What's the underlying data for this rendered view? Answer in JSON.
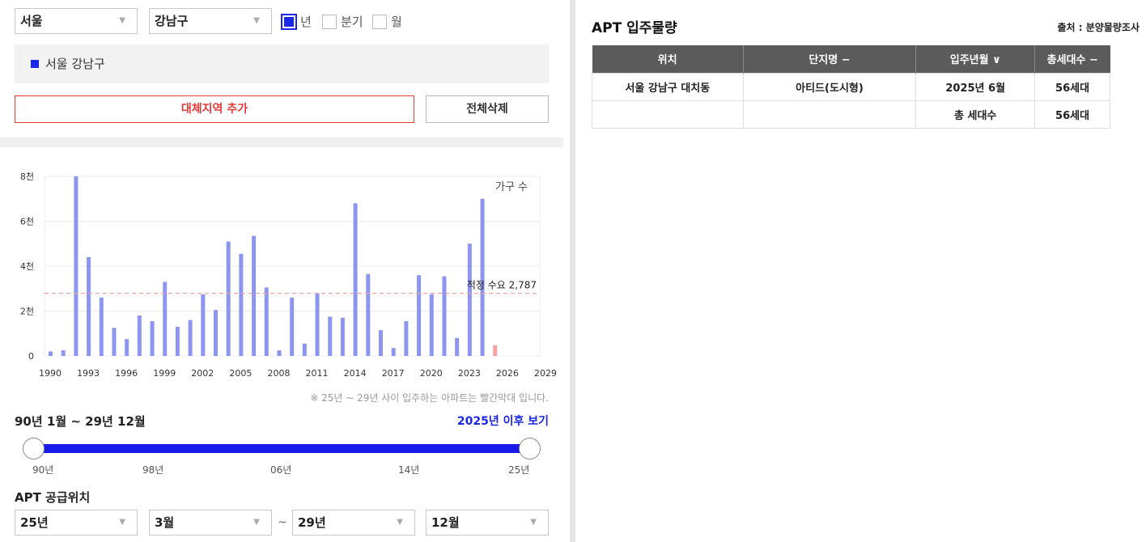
{
  "filters": {
    "city": "서울",
    "district": "강남구",
    "period_options": [
      {
        "label": "년",
        "checked": true
      },
      {
        "label": "분기",
        "checked": false
      },
      {
        "label": "월",
        "checked": false
      }
    ]
  },
  "selected_region": "서울 강남구",
  "buttons": {
    "add_region": "대체지역 추가",
    "delete_all": "전체삭제"
  },
  "chart_data": {
    "type": "bar",
    "legend": "가구 수",
    "x_tick_labels": [
      "1990",
      "1993",
      "1996",
      "1999",
      "2002",
      "2005",
      "2008",
      "2011",
      "2014",
      "2017",
      "2020",
      "2023",
      "2026",
      "2029"
    ],
    "y_tick_labels": [
      "0",
      "2천",
      "4천",
      "6천",
      "8천"
    ],
    "ylim": [
      0,
      8000
    ],
    "xlim": [
      1990,
      2029
    ],
    "years": [
      1990,
      1991,
      1992,
      1993,
      1994,
      1995,
      1996,
      1997,
      1998,
      1999,
      2000,
      2001,
      2002,
      2003,
      2004,
      2005,
      2006,
      2007,
      2008,
      2009,
      2010,
      2011,
      2012,
      2013,
      2014,
      2015,
      2016,
      2017,
      2018,
      2019,
      2020,
      2021,
      2022,
      2023,
      2024,
      2025
    ],
    "values": [
      200,
      250,
      8000,
      4400,
      2600,
      1250,
      750,
      1800,
      1550,
      3300,
      1300,
      1600,
      2750,
      2050,
      5100,
      4550,
      5350,
      3050,
      250,
      2600,
      550,
      2800,
      1750,
      1700,
      6800,
      3650,
      1150,
      350,
      1550,
      3600,
      2750,
      3550,
      800,
      5000,
      7000,
      480
    ],
    "projection_start_year": 2025,
    "colors": {
      "past": "#8c96ee",
      "future": "#f4a3a3",
      "guide": "#f4a3a3"
    },
    "reference_line": {
      "label": "적정 수요 2,787",
      "value": 2787
    },
    "grid": true
  },
  "note": "※ 25년 ~ 29년 사이 입주하는 아파트는 빨간막대 입니다.",
  "range": {
    "title": "90년 1월 ~ 29년 12월",
    "after_link": "2025년 이후 보기",
    "tick_labels": [
      "90년",
      "98년",
      "06년",
      "14년",
      "25년"
    ]
  },
  "supply": {
    "title": "APT 공급위치",
    "from_year": "25년",
    "from_month": "3월",
    "separator": "~",
    "to_year": "29년",
    "to_month": "12월"
  },
  "right": {
    "title": "APT 입주물량",
    "source": "출처 : 분양물량조사",
    "columns": [
      "위치",
      "단지명 −",
      "입주년월 ∨",
      "총세대수 −"
    ],
    "rows": [
      [
        "서울 강남구 대치동",
        "아티드(도시형)",
        "2025년 6월",
        "56세대"
      ],
      [
        "",
        "",
        "총 세대수",
        "56세대"
      ]
    ]
  }
}
